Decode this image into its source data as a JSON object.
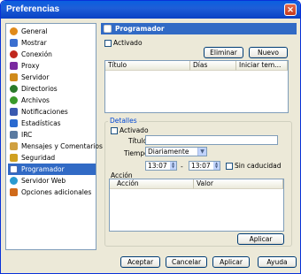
{
  "window": {
    "title": "Preferencias",
    "close_glyph": "✕"
  },
  "sidebar": {
    "items": [
      {
        "label": "General",
        "icon": "general-icon",
        "color": "#e08a1a"
      },
      {
        "label": "Mostrar",
        "icon": "display-icon",
        "color": "#3a6fd0"
      },
      {
        "label": "Conexión",
        "icon": "connection-icon",
        "color": "#c0281e"
      },
      {
        "label": "Proxy",
        "icon": "proxy-icon",
        "color": "#7a2aa0"
      },
      {
        "label": "Servidor",
        "icon": "server-icon",
        "color": "#d08a1a"
      },
      {
        "label": "Directorios",
        "icon": "folders-icon",
        "color": "#2a7a2a"
      },
      {
        "label": "Archivos",
        "icon": "files-icon",
        "color": "#3a9a2a"
      },
      {
        "label": "Notificaciones",
        "icon": "notifications-icon",
        "color": "#3a5ab0"
      },
      {
        "label": "Estadísticas",
        "icon": "statistics-icon",
        "color": "#2a6ad0"
      },
      {
        "label": "IRC",
        "icon": "irc-icon",
        "color": "#5a7aa0"
      },
      {
        "label": "Mensajes y Comentarios",
        "icon": "messages-icon",
        "color": "#d0a040"
      },
      {
        "label": "Seguridad",
        "icon": "lock-icon",
        "color": "#d0a020"
      },
      {
        "label": "Programador",
        "icon": "scheduler-icon",
        "color": "#4a6ab0",
        "selected": true
      },
      {
        "label": "Servidor Web",
        "icon": "web-server-icon",
        "color": "#2a9ad0"
      },
      {
        "label": "Opciones adicionales",
        "icon": "extra-options-icon",
        "color": "#d06a1a"
      }
    ]
  },
  "panel": {
    "title": "Programador",
    "activado_label": "Activado",
    "eliminar_label": "Eliminar",
    "nuevo_label": "Nuevo",
    "columns": [
      "Título",
      "Días",
      "Iniciar tem..."
    ],
    "details": {
      "legend": "Detalles",
      "activado_label": "Activado",
      "titulo_label": "Título",
      "titulo_value": "",
      "tiempo_label": "Tiempo",
      "tiempo_value": "Diariamente",
      "start_time": "13:07",
      "dash": "-",
      "end_time": "13:07",
      "sin_caducidad_label": "Sin caducidad",
      "accion_label": "Acción",
      "action_columns": [
        "Acción",
        "Valor"
      ],
      "aplicar_label": "Aplicar"
    }
  },
  "footer": {
    "aceptar": "Aceptar",
    "cancelar": "Cancelar",
    "aplicar": "Aplicar",
    "ayuda": "Ayuda"
  }
}
